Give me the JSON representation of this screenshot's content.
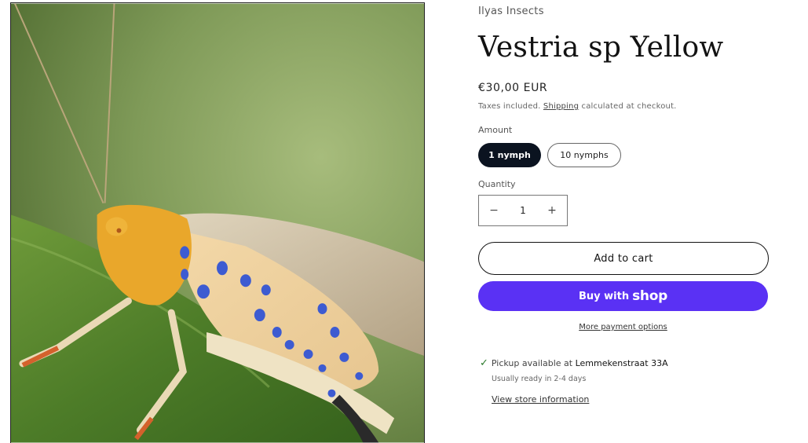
{
  "product": {
    "vendor": "Ilyas Insects",
    "title": "Vestria sp Yellow",
    "price": "€30,00 EUR",
    "tax_prefix": "Taxes included.",
    "shipping_link": "Shipping",
    "tax_suffix": "calculated at checkout.",
    "image_alt": "Vestria sp Yellow katydid on a leaf"
  },
  "amount": {
    "label": "Amount",
    "options": [
      "1 nymph",
      "10 nymphs"
    ],
    "selected": "1 nymph"
  },
  "quantity": {
    "label": "Quantity",
    "value": "1",
    "decrease_symbol": "−",
    "increase_symbol": "+"
  },
  "actions": {
    "add_to_cart": "Add to cart",
    "buy_with": "Buy with",
    "shop_brand": "shop",
    "more_payment": "More payment options",
    "brand_color": "#5a31f4"
  },
  "pickup": {
    "prefix": "Pickup available at",
    "location": "Lemmekenstraat 33A",
    "ready": "Usually ready in 2-4 days",
    "store_link": "View store information",
    "check_icon": "check-icon"
  }
}
